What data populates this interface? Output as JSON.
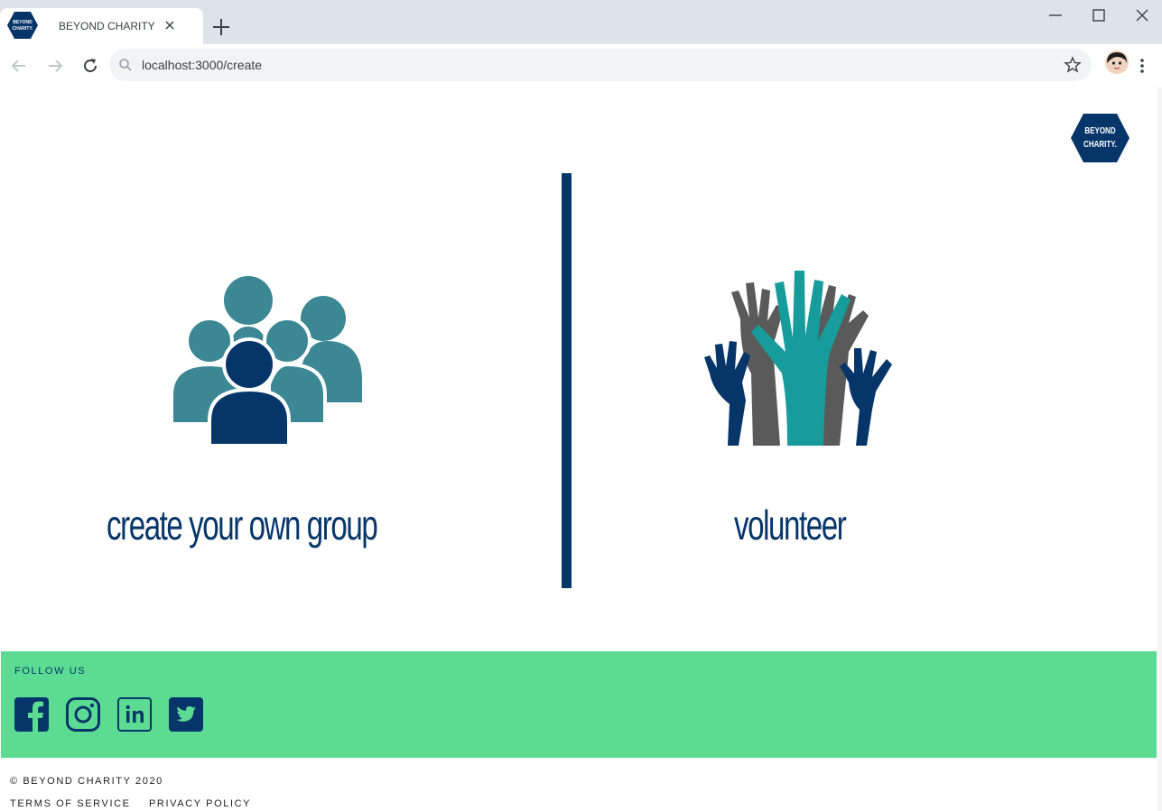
{
  "browser": {
    "tab_title": "BEYOND CHARITY",
    "url": "localhost:3000/create",
    "favicon_text": [
      "BEYOND",
      "CHARITY."
    ],
    "icons": [
      "back-icon",
      "forward-icon",
      "reload-icon",
      "search-icon",
      "star-icon",
      "new-tab-icon",
      "close-icon",
      "minimize-icon",
      "maximize-icon",
      "menu-icon"
    ]
  },
  "site": {
    "logo_line1": "BEYOND",
    "logo_line2": "CHARITY.",
    "options": [
      {
        "label": "create your own group",
        "icon": "group-people-icon"
      },
      {
        "label": "volunteer",
        "icon": "raised-hands-icon"
      }
    ]
  },
  "footer": {
    "follow_label": "FOLLOW US",
    "social": [
      "facebook-icon",
      "instagram-icon",
      "linkedin-icon",
      "twitter-icon"
    ],
    "copyright": "© BEYOND CHARITY 2020",
    "terms": "TERMS OF SERVICE",
    "privacy": "PRIVACY POLICY"
  },
  "colors": {
    "navy": "#06356a",
    "teal": "#3b8794",
    "hand_teal": "#169c9a",
    "hand_gray": "#5a5a5a",
    "footer_green": "#5cdc93",
    "chrome_bg": "#dee3e9"
  }
}
